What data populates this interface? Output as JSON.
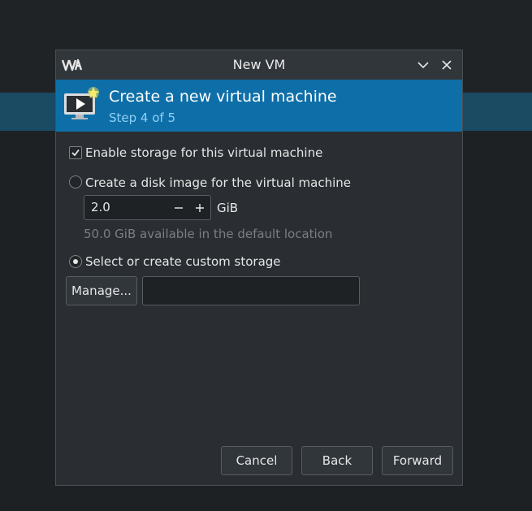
{
  "window": {
    "title": "New VM",
    "app_icon": "virt-manager-logo-icon",
    "collapse_icon": "chevron-down-icon",
    "close_icon": "close-icon"
  },
  "banner": {
    "title": "Create a new virtual machine",
    "subtitle": "Step 4 of 5",
    "icon": "monitor-play-star-icon",
    "color": "#0e6fa8"
  },
  "storage": {
    "enable_label": "Enable storage for this virtual machine",
    "enable_checked": true,
    "disk_image_label": "Create a disk image for the virtual machine",
    "disk_image_selected": false,
    "size_value": "2.0",
    "size_unit": "GiB",
    "available_text": "50.0 GiB available in the default location",
    "custom_label": "Select or create custom storage",
    "custom_selected": true,
    "manage_label": "Manage...",
    "path_value": ""
  },
  "buttons": {
    "cancel": "Cancel",
    "back": "Back",
    "forward": "Forward"
  }
}
